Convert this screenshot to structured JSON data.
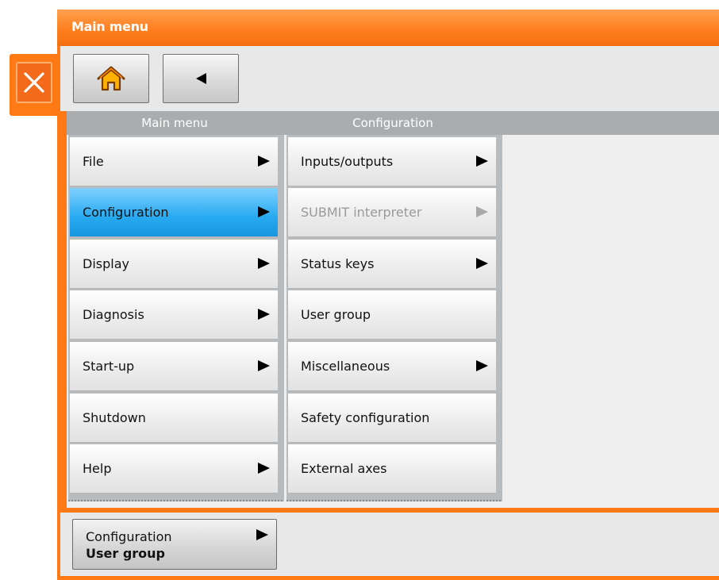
{
  "window": {
    "title": "Main menu"
  },
  "toolbar": {
    "home_icon": "home-icon",
    "back_icon": "back-arrow-icon",
    "close_icon": "close-icon"
  },
  "columns": {
    "main_menu": {
      "header": "Main menu",
      "items": [
        {
          "label": "File",
          "has_submenu": true,
          "selected": false,
          "disabled": false
        },
        {
          "label": "Configuration",
          "has_submenu": true,
          "selected": true,
          "disabled": false
        },
        {
          "label": "Display",
          "has_submenu": true,
          "selected": false,
          "disabled": false
        },
        {
          "label": "Diagnosis",
          "has_submenu": true,
          "selected": false,
          "disabled": false
        },
        {
          "label": "Start-up",
          "has_submenu": true,
          "selected": false,
          "disabled": false
        },
        {
          "label": "Shutdown",
          "has_submenu": false,
          "selected": false,
          "disabled": false
        },
        {
          "label": "Help",
          "has_submenu": true,
          "selected": false,
          "disabled": false
        }
      ]
    },
    "configuration": {
      "header": "Configuration",
      "items": [
        {
          "label": "Inputs/outputs",
          "has_submenu": true,
          "selected": false,
          "disabled": false
        },
        {
          "label": "SUBMIT interpreter",
          "has_submenu": true,
          "selected": false,
          "disabled": true
        },
        {
          "label": "Status keys",
          "has_submenu": true,
          "selected": false,
          "disabled": false
        },
        {
          "label": "User group",
          "has_submenu": false,
          "selected": false,
          "disabled": false
        },
        {
          "label": "Miscellaneous",
          "has_submenu": true,
          "selected": false,
          "disabled": false
        },
        {
          "label": "Safety configuration",
          "has_submenu": false,
          "selected": false,
          "disabled": false
        },
        {
          "label": "External axes",
          "has_submenu": false,
          "selected": false,
          "disabled": false
        }
      ]
    }
  },
  "breadcrumb": {
    "parent": "Configuration",
    "current": "User group"
  },
  "colors": {
    "accent": "#ff7a14",
    "selected": "#28aaf0",
    "column_header": "#a9adb0"
  }
}
